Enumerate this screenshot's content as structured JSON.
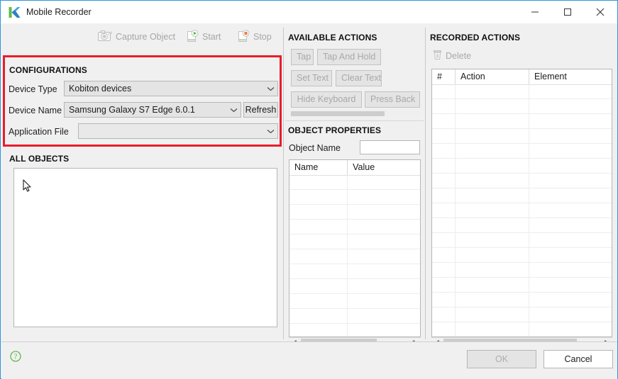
{
  "window": {
    "title": "Mobile Recorder",
    "logo_icon": "katalon-k-logo",
    "controls": {
      "minimize": "minimize-icon",
      "maximize": "maximize-icon",
      "close": "close-icon"
    }
  },
  "toolbar": {
    "items": [
      {
        "label": "Capture Object",
        "icon": "camera-icon",
        "enabled": false
      },
      {
        "label": "Start",
        "icon": "start-record-icon",
        "enabled": false
      },
      {
        "label": "Stop",
        "icon": "stop-record-icon",
        "enabled": false
      }
    ]
  },
  "configurations": {
    "heading": "CONFIGURATIONS",
    "device_type": {
      "label": "Device Type",
      "value": "Kobiton devices",
      "arrow_icon": "chevron-down-icon"
    },
    "device_name": {
      "label": "Device Name",
      "value": "Samsung Galaxy S7 Edge 6.0.1",
      "arrow_icon": "chevron-down-icon"
    },
    "application_file": {
      "label": "Application File",
      "value": "",
      "arrow_icon": "chevron-down-icon"
    },
    "refresh_label": "Refresh"
  },
  "all_objects": {
    "heading": "ALL OBJECTS",
    "items": []
  },
  "available_actions": {
    "heading": "AVAILABLE ACTIONS",
    "buttons": [
      {
        "label": "Tap",
        "enabled": false
      },
      {
        "label": "Tap And Hold",
        "enabled": false
      },
      {
        "label": "Set Text",
        "enabled": false
      },
      {
        "label": "Clear Text",
        "enabled": false
      },
      {
        "label": "Hide Keyboard",
        "enabled": false
      },
      {
        "label": "Press Back",
        "enabled": false
      }
    ]
  },
  "object_properties": {
    "heading": "OBJECT PROPERTIES",
    "object_name_label": "Object Name",
    "object_name_value": "",
    "columns": [
      "Name",
      "Value"
    ],
    "rows": []
  },
  "recorded_actions": {
    "heading": "RECORDED ACTIONS",
    "delete_label": "Delete",
    "delete_icon": "trash-icon",
    "columns": [
      "#",
      "Action",
      "Element"
    ],
    "rows": []
  },
  "footer": {
    "help_icon": "help-question-icon",
    "ok_label": "OK",
    "cancel_label": "Cancel"
  },
  "annotation": {
    "highlight_color": "#e81d2c",
    "target": "configurations"
  },
  "colors": {
    "accent": "#2f94e0",
    "panel": "#f0f0f0",
    "highlight": "#e81d2c",
    "disabled_text": "#a8a8a8",
    "help_green": "#4caf2f"
  }
}
